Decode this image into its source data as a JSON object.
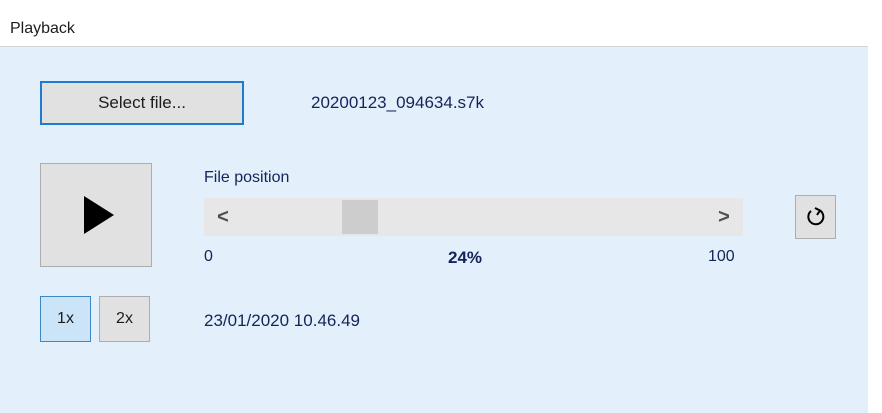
{
  "header": {
    "title": "Playback"
  },
  "file": {
    "select_label": "Select file...",
    "filename": "20200123_094634.s7k"
  },
  "playback": {
    "play_icon": "play-icon",
    "loop_icon": "loop-icon"
  },
  "position": {
    "label": "File position",
    "min": "0",
    "max": "100",
    "percent_label": "24%",
    "value": 24,
    "left_arrow": "<",
    "right_arrow": ">"
  },
  "speed": {
    "options": [
      "1x",
      "2x"
    ],
    "selected": "1x"
  },
  "timestamp": "23/01/2020 10.46.49",
  "colors": {
    "panel_bg": "#e3f0fb",
    "accent_border": "#1b7cd2",
    "text": "#14245a"
  }
}
